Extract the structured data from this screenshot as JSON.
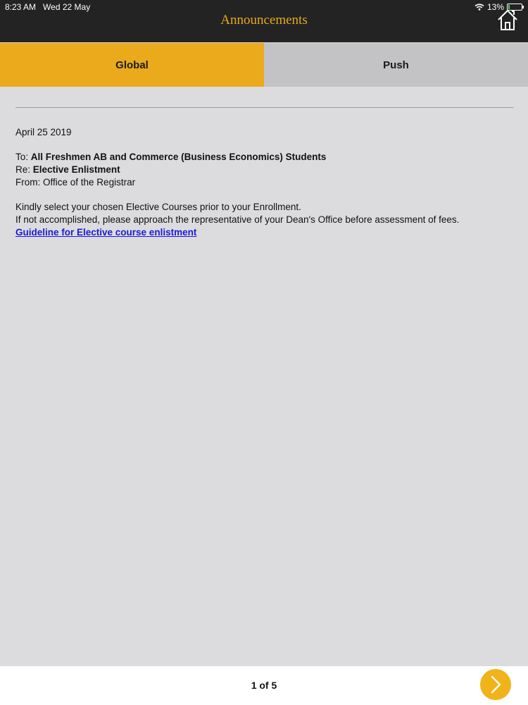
{
  "status_bar": {
    "time": "8:23 AM",
    "date": "Wed 22 May",
    "battery": "13%",
    "battery_level": 0.13
  },
  "header": {
    "title": "Announcements",
    "home_icon": "home-icon"
  },
  "tabs": [
    {
      "label": "Global",
      "active": true
    },
    {
      "label": "Push",
      "active": false
    }
  ],
  "announcement": {
    "date": "April 25 2019",
    "to_label": "To:",
    "to_value": "All Freshmen AB and Commerce (Business Economics) Students",
    "re_label": "Re:",
    "re_value": "Elective Enlistment",
    "from_label": "From:",
    "from_value": "Office of the Registrar",
    "body_line_1": "Kindly select your chosen Elective Courses prior to your Enrollment.",
    "body_line_2": "If not accomplished, please approach the representative of your Dean's Office before assessment of fees.",
    "link_text": "Guideline for Elective course enlistment"
  },
  "footer": {
    "page_indicator": "1 of 5",
    "next_icon": "chevron-right-icon"
  },
  "colors": {
    "accent": "#eaaa1b",
    "header_bg": "#232323",
    "link": "#1a1ad8"
  }
}
